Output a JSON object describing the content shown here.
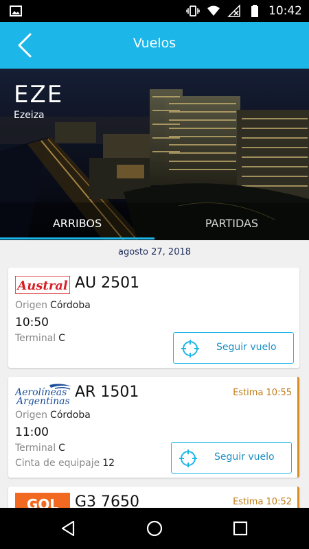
{
  "status_bar": {
    "time": "10:42",
    "icons": [
      "image-icon",
      "vibrate-icon",
      "wifi-icon",
      "signal-off-icon",
      "battery-icon"
    ]
  },
  "app_bar": {
    "title": "Vuelos",
    "back_icon": "chevron-left-icon"
  },
  "airport": {
    "code": "EZE",
    "name": "Ezeiza"
  },
  "tabs": [
    {
      "label": "ARRIBOS",
      "active": true
    },
    {
      "label": "PARTIDAS",
      "active": false
    }
  ],
  "date": "agosto 27, 2018",
  "flights": [
    {
      "airline_logo": "Austral",
      "flight_number": "AU 2501",
      "estimate": "",
      "origin_label": "Origen",
      "origin": "Córdoba",
      "time": "10:50",
      "terminal_label": "Terminal",
      "terminal": "C",
      "button_label": "Seguir vuelo"
    },
    {
      "airline_logo_line1": "Aerolíneas",
      "airline_logo_line2": "Argentinas",
      "flight_number": "AR 1501",
      "estimate": "Estima 10:55",
      "origin_label": "Origen",
      "origin": "Córdoba",
      "time": "11:00",
      "terminal_label": "Terminal",
      "terminal": "C",
      "baggage_label": "Cinta de equipaje",
      "baggage": "12",
      "button_label": "Seguir vuelo"
    },
    {
      "airline_logo": "GOL",
      "flight_number": "G3 7650",
      "estimate": "Estima 10:52"
    }
  ],
  "colors": {
    "accent": "#1cb6e8",
    "estimate": "#c07a13",
    "delay_border": "#d98c1f",
    "austral_red": "#d61f26",
    "aerolineas_blue": "#1a4e9a",
    "gol_orange": "#f26a21"
  }
}
